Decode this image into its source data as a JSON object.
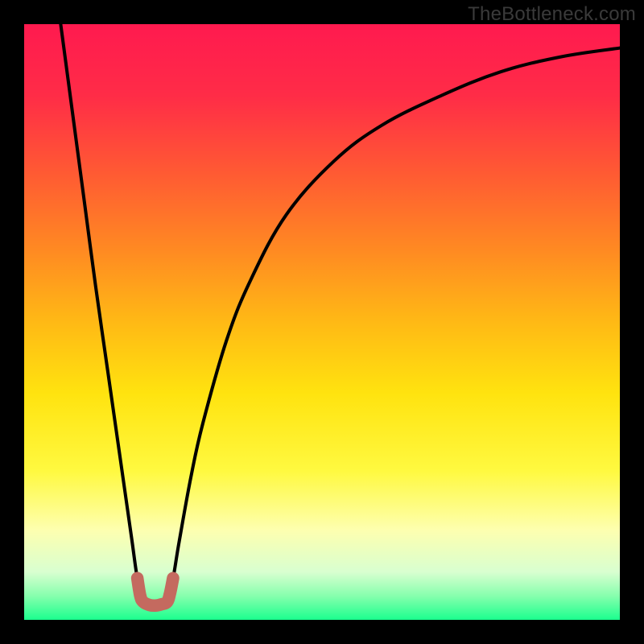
{
  "watermark": "TheBottleneck.com",
  "chart_data": {
    "type": "line",
    "title": "",
    "xlabel": "",
    "ylabel": "",
    "xlim": [
      0,
      100
    ],
    "ylim": [
      0,
      100
    ],
    "grid": false,
    "legend": false,
    "background_gradient": [
      {
        "stop": 0.0,
        "color": "#ff1a4f"
      },
      {
        "stop": 0.12,
        "color": "#ff2c47"
      },
      {
        "stop": 0.25,
        "color": "#ff5a33"
      },
      {
        "stop": 0.38,
        "color": "#ff8a22"
      },
      {
        "stop": 0.5,
        "color": "#ffb915"
      },
      {
        "stop": 0.62,
        "color": "#ffe30f"
      },
      {
        "stop": 0.75,
        "color": "#fff940"
      },
      {
        "stop": 0.85,
        "color": "#fdffb0"
      },
      {
        "stop": 0.92,
        "color": "#d8ffd0"
      },
      {
        "stop": 0.96,
        "color": "#86ffad"
      },
      {
        "stop": 1.0,
        "color": "#1bff8e"
      }
    ],
    "series": [
      {
        "name": "left-branch",
        "x": [
          6,
          8,
          10,
          12,
          14,
          16,
          18,
          19,
          20
        ],
        "values": [
          101,
          86,
          71,
          56,
          42,
          28,
          14,
          7,
          3
        ]
      },
      {
        "name": "right-branch",
        "x": [
          24,
          25,
          26,
          28,
          30,
          34,
          38,
          44,
          52,
          60,
          70,
          80,
          90,
          100
        ],
        "values": [
          3,
          7,
          13,
          24,
          33,
          47,
          57,
          68,
          77,
          83,
          88,
          92,
          94.5,
          96
        ]
      }
    ],
    "marker_segment": {
      "name": "valley-marker",
      "color": "#c46a5f",
      "points_xy": [
        [
          19,
          7
        ],
        [
          19.5,
          4
        ],
        [
          20,
          3
        ],
        [
          21,
          2.5
        ],
        [
          22,
          2.4
        ],
        [
          23,
          2.6
        ],
        [
          24,
          3
        ],
        [
          24.5,
          4.5
        ],
        [
          25,
          7
        ]
      ]
    }
  }
}
